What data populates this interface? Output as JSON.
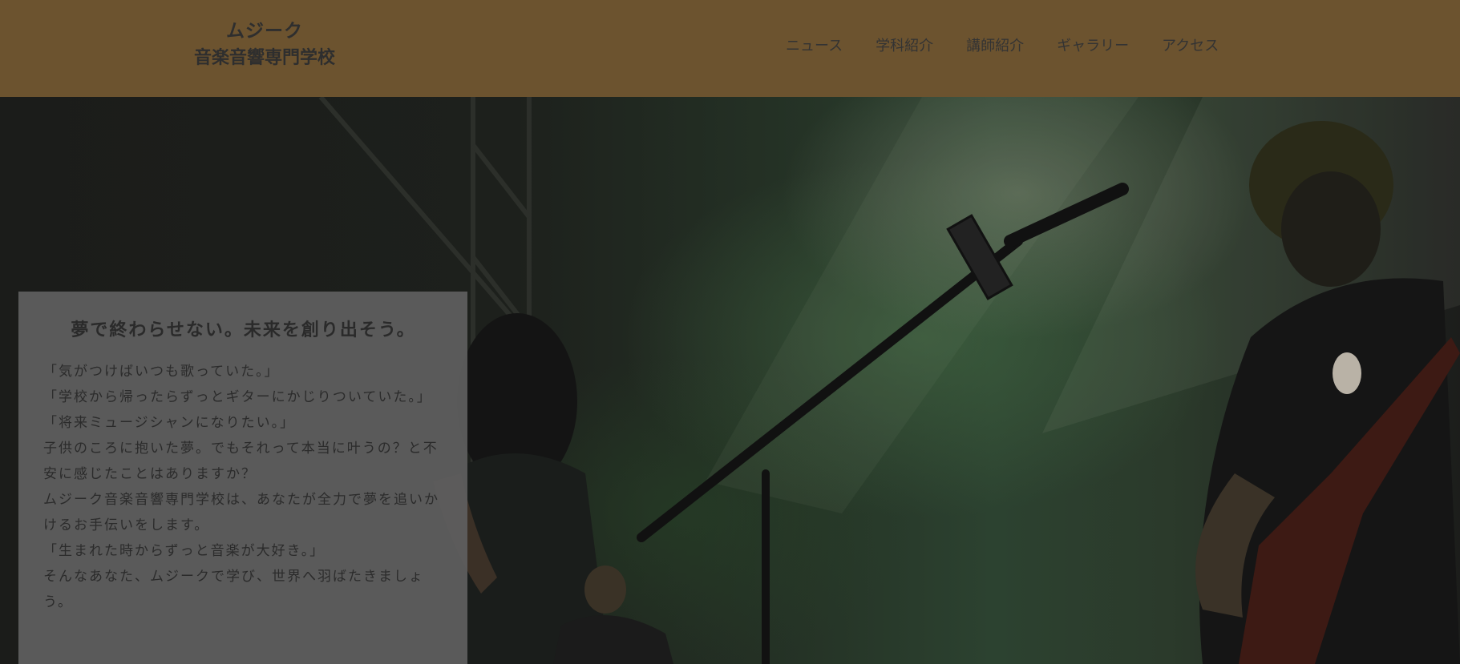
{
  "header": {
    "logo_line1": "ムジーク",
    "logo_line2": "音楽音響専門学校",
    "nav": [
      {
        "label": "ニュース"
      },
      {
        "label": "学科紹介"
      },
      {
        "label": "講師紹介"
      },
      {
        "label": "ギャラリー"
      },
      {
        "label": "アクセス"
      }
    ]
  },
  "hero": {
    "image_alt": "concert-stage-photo",
    "card": {
      "title": "夢で終わらせない。未来を創り出そう。",
      "paragraphs": [
        "「気がつけばいつも歌っていた。」",
        "「学校から帰ったらずっとギターにかじりついていた。」",
        "「将来ミュージシャンになりたい。」",
        "子供のころに抱いた夢。でもそれって本当に叶うの？と不安に感じたことはありますか？",
        "ムジーク音楽音響専門学校は、あなたが全力で夢を追いかけるお手伝いをします。",
        "「生まれた時からずっと音楽が大好き。」",
        "そんなあなた、ムジークで学び、世界へ羽ばたきましょう。"
      ]
    }
  },
  "colors": {
    "header_bg": "#6c532f",
    "card_bg": "#606060"
  }
}
